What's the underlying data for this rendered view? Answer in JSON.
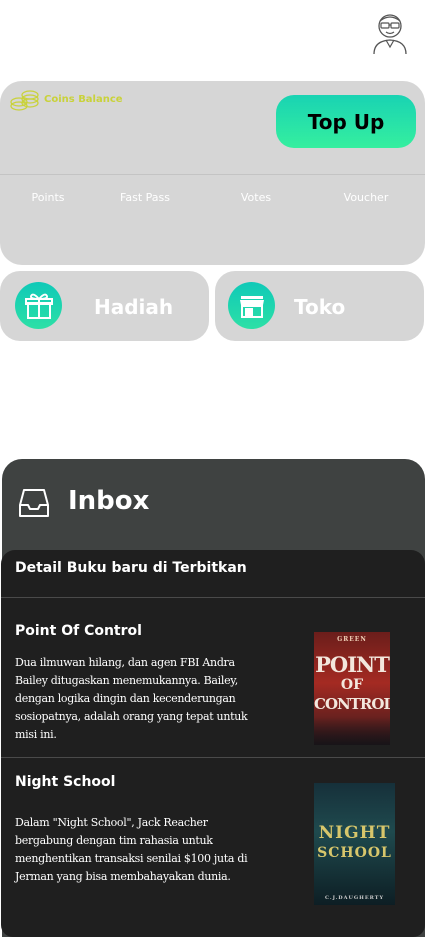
{
  "header": {
    "avatar_icon": "user-avatar-icon"
  },
  "balance": {
    "label": "Coins Balance",
    "coins_icon": "coins-icon",
    "topup_label": "Top Up",
    "stats": [
      "Points",
      "Fast Pass",
      "Votes",
      "Voucher"
    ]
  },
  "quick_actions": [
    {
      "label": "Hadiah",
      "icon": "gift-icon"
    },
    {
      "label": "Toko",
      "icon": "store-icon"
    }
  ],
  "inbox": {
    "title": "Inbox",
    "icon": "inbox-tray-icon",
    "notice": "Detail Buku baru di Terbitkan",
    "books": [
      {
        "title": "Point Of Control",
        "description": "Dua ilmuwan hilang, dan agen FBI Andra Bailey ditugaskan menemukannya. Bailey, dengan logika dingin dan kecenderungan sosiopatnya, adalah orang yang tepat untuk misi ini.",
        "cover": {
          "author": "GREEN",
          "line1": "POINT",
          "line2": "OF",
          "line3": "CONTROL"
        }
      },
      {
        "title": "Night School",
        "description": "Dalam \"Night School\", Jack Reacher bergabung dengan tim rahasia untuk menghentikan transaksi senilai $100 juta di Jerman yang bisa membahayakan dunia.",
        "cover": {
          "line1": "NIGHT",
          "line2": "SCHOOL",
          "author": "C.J.DAUGHERTY"
        }
      }
    ]
  },
  "colors": {
    "accent_gradient_start": "#19d3b3",
    "accent_gradient_end": "#35ef9f",
    "card_bg": "#d6d6d6",
    "inbox_bg": "#3f4241",
    "list_bg": "#1f1f1f",
    "coins_label": "#c9d23a"
  }
}
